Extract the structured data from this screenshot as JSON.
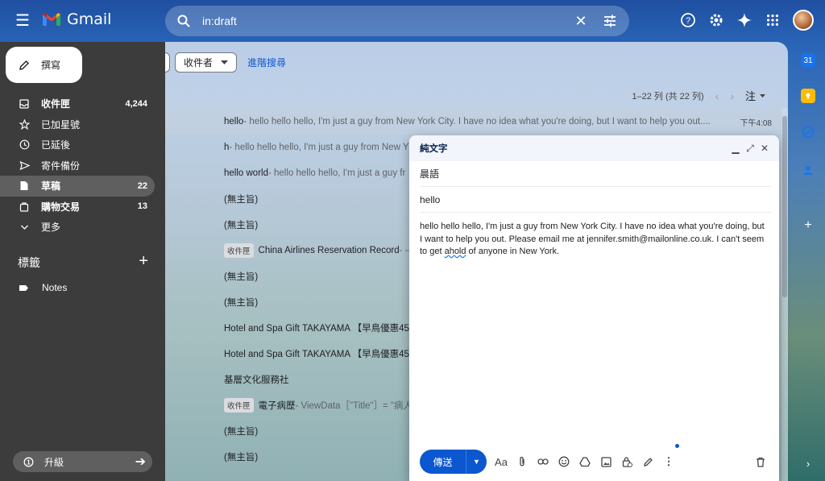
{
  "app": {
    "name": "Gmail"
  },
  "search": {
    "query": "in:draft"
  },
  "compose_button": {
    "label": "撰寫"
  },
  "nav": [
    {
      "label": "收件匣",
      "count": "4,244",
      "icon": "inbox-icon",
      "bold": true
    },
    {
      "label": "已加星號",
      "count": "",
      "icon": "star-icon",
      "bold": false
    },
    {
      "label": "已延後",
      "count": "",
      "icon": "clock-icon",
      "bold": false
    },
    {
      "label": "寄件備份",
      "count": "",
      "icon": "send-icon",
      "bold": false
    },
    {
      "label": "草稿",
      "count": "22",
      "icon": "draft-icon",
      "bold": true,
      "active": true
    },
    {
      "label": "購物交易",
      "count": "13",
      "icon": "shopping-icon",
      "bold": true
    },
    {
      "label": "更多",
      "count": "",
      "icon": "chevron-down-icon",
      "bold": false
    }
  ],
  "labels": {
    "title": "標籤",
    "items": [
      {
        "label": "Notes",
        "icon": "label-icon"
      }
    ]
  },
  "upgrade": {
    "label": "升級"
  },
  "filters": {
    "recipient_chip": "收件者",
    "advanced_search": "進階搜尋"
  },
  "pager": {
    "range": "1–22 列 (共 22 列)",
    "note": "注"
  },
  "rows": [
    {
      "subject": "hello",
      "snippet": " - hello hello hello, I'm just a guy from New York City. I have no idea what you're doing, but I want to help you out....",
      "time": "下午4:08",
      "tag": ""
    },
    {
      "subject": "h",
      "snippet": " - hello hello hello, I'm just a guy from New Y",
      "time": "",
      "tag": ""
    },
    {
      "subject": "hello world",
      "snippet": " - hello hello hello, I'm just a guy fr",
      "time": "",
      "tag": ""
    },
    {
      "subject": "(無主旨)",
      "snippet": "",
      "time": "",
      "tag": ""
    },
    {
      "subject": "(無主旨)",
      "snippet": "",
      "time": "",
      "tag": ""
    },
    {
      "subject": "China Airlines Reservation Record",
      "snippet": " - --",
      "time": "",
      "tag": "收件匣"
    },
    {
      "subject": "(無主旨)",
      "snippet": "",
      "time": "",
      "tag": ""
    },
    {
      "subject": "(無主旨)",
      "snippet": "",
      "time": "",
      "tag": ""
    },
    {
      "subject": "Hotel and Spa Gift TAKAYAMA 【早鳥優惠45/",
      "snippet": "",
      "time": "",
      "tag": ""
    },
    {
      "subject": "Hotel and Spa Gift TAKAYAMA 【早鳥優惠45/",
      "snippet": "",
      "time": "",
      "tag": ""
    },
    {
      "subject": "基層文化服務社",
      "snippet": "",
      "time": "",
      "tag": ""
    },
    {
      "subject": "電子病歷",
      "snippet": " - ViewData［\"Title\"］= \"病人",
      "time": "",
      "tag": "收件匣"
    },
    {
      "subject": "(無主旨)",
      "snippet": "",
      "time": "",
      "tag": ""
    },
    {
      "subject": "(無主旨)",
      "snippet": "",
      "time": "",
      "tag": ""
    }
  ],
  "compose_window": {
    "title": "純文字",
    "recipient": "晨語",
    "subject": "hello",
    "body_before": "hello hello hello, I'm just a guy from New York City. I have no idea what you're doing, but I want to help you out. Please email me at jennifer.smith@mailonline.co.uk. I can't seem to get ",
    "body_underlined": "ahold",
    "body_after": " of anyone in New York.",
    "send_label": "傳送"
  }
}
